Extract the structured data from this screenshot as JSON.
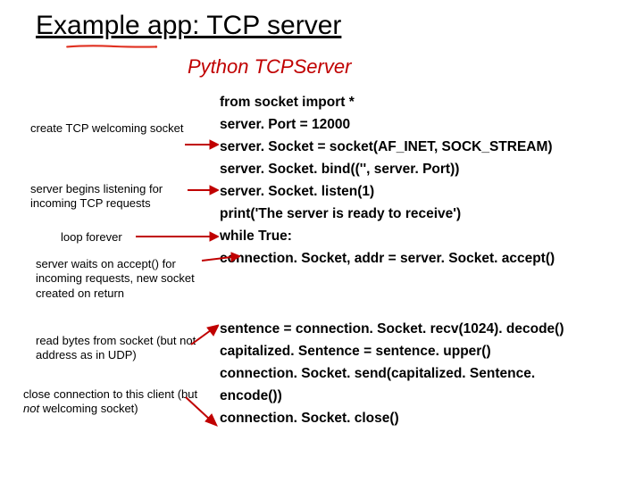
{
  "title": "Example app: TCP server",
  "subtitle": "Python TCPServer",
  "annotations": {
    "a1": "create TCP welcoming socket",
    "a2": "server begins listening for incoming TCP requests",
    "a3": "loop forever",
    "a4": "server waits on accept() for incoming requests, new socket created on return",
    "a5": "read bytes from socket (but not address as in UDP)",
    "a6": "close connection to this client (but ",
    "a6_not": "not",
    "a6_rest": " welcoming socket)"
  },
  "code": {
    "l1": "from socket import *",
    "l2": "server. Port = 12000",
    "l3": "server. Socket = socket(AF_INET, SOCK_STREAM)",
    "l4": "server. Socket. bind(('', server. Port))",
    "l5": "server. Socket. listen(1)",
    "l6": "print('The server is ready to receive')",
    "l7": "while True:",
    "l8": "   connection. Socket, addr = server. Socket. accept()",
    "l9": "sentence = connection. Socket. recv(1024). decode()",
    "l10": "capitalized. Sentence = sentence. upper()",
    "l11": "connection. Socket. send(capitalized. Sentence.",
    "l12": "                                                               encode())",
    "l13": "connection. Socket. close()"
  }
}
